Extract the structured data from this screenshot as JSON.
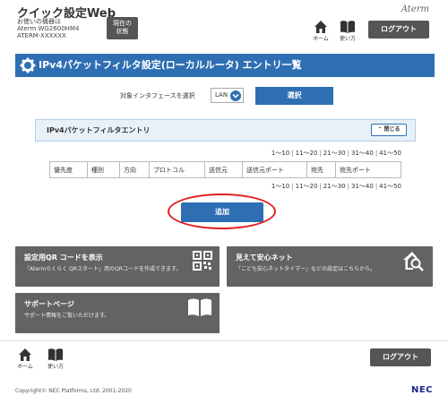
{
  "header": {
    "app_title": "クイック設定Web",
    "device_caption": "お使いの機器は",
    "model": "Aterm WG2600HM4",
    "ssid": "ATERM-XXXXXX",
    "status_button": [
      "現在の",
      "状態"
    ],
    "logo": "Aterm",
    "home_label": "ホーム",
    "help_label": "使い方",
    "logout_label": "ログアウト"
  },
  "page": {
    "title": "IPv4パケットフィルタ設定(ローカルルータ) エントリ一覧",
    "iface_label": "対象インタフェースを選択",
    "iface_value": "LAN",
    "select_button": "選択"
  },
  "panel": {
    "title": "IPv4パケットフィルタエントリ",
    "close_label": "閉じる"
  },
  "pager": [
    "1〜10",
    "11〜20",
    "21〜30",
    "31〜40",
    "41〜50"
  ],
  "table": {
    "columns": [
      "優先度",
      "種別",
      "方向",
      "プロトコル",
      "送信元",
      "送信元ポート",
      "宛先",
      "宛先ポート"
    ]
  },
  "add_button": "追加",
  "tiles": [
    {
      "title": "設定用QR コードを表示",
      "desc": "「Atermらくらく QRスタート」用のQRコードを作成できます。",
      "icon": "qr-code-icon"
    },
    {
      "title": "見えて安心ネット",
      "desc": "「こども安心ネットタイマー」などの設定はこちらから。",
      "icon": "home-search-icon"
    },
    {
      "title": "サポートページ",
      "desc": "サポート情報をご覧いただけます。",
      "icon": "book-icon"
    }
  ],
  "footer": {
    "home_label": "ホーム",
    "help_label": "使い方",
    "logout_label": "ログアウト",
    "copyright": "Copyright© NEC Platforms, Ltd. 2001-2020",
    "nec_logo": "NEC"
  },
  "colors": {
    "accent": "#2e6fb3",
    "tile": "#636363",
    "highlight": "#e21d1d"
  }
}
